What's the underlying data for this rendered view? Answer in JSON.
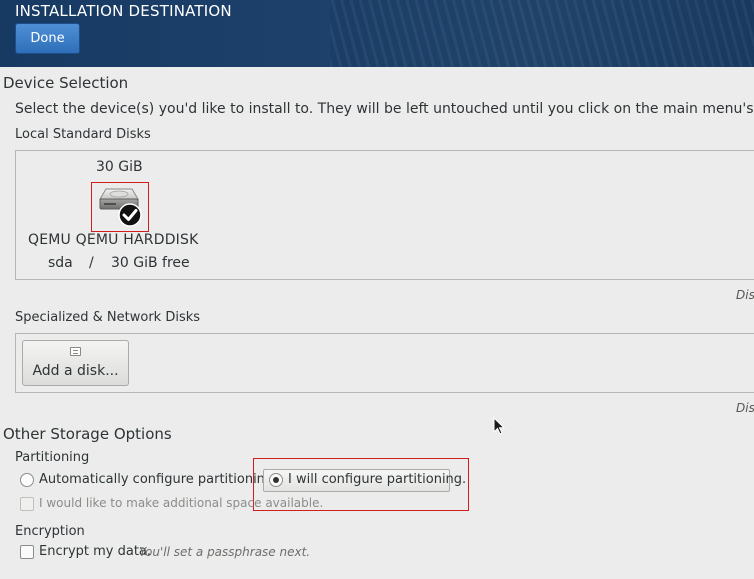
{
  "header": {
    "title": "INSTALLATION DESTINATION",
    "done_label": "Done"
  },
  "device_selection": {
    "heading": "Device Selection",
    "instruction": "Select the device(s) you'd like to install to.  They will be left untouched until you click on the main menu's \"",
    "local_disks": {
      "heading": "Local Standard Disks",
      "disks": [
        {
          "size": "30 GiB",
          "name": "QEMU QEMU HARDDISK",
          "device": "sda",
          "separator": "/",
          "free": "30 GiB free",
          "selected": true,
          "icon": "harddisk-icon"
        }
      ],
      "side_link": "Dis"
    },
    "network_disks": {
      "heading": "Specialized & Network Disks",
      "add_disk_label": "Add a disk...",
      "side_link": "Dis"
    }
  },
  "other_storage": {
    "heading": "Other Storage Options",
    "partitioning": {
      "heading": "Partitioning",
      "options": [
        {
          "label": "Automatically configure partitioning.",
          "selected": false
        },
        {
          "label": "I will configure partitioning.",
          "selected": true
        }
      ],
      "extra_space_label": "I would like to make additional space available.",
      "extra_space_checked": false,
      "extra_space_enabled": false
    },
    "encryption": {
      "heading": "Encryption",
      "label": "Encrypt my data.",
      "hint": "You'll set a passphrase next.",
      "checked": false
    }
  },
  "colors": {
    "header_bg": "#1d416b",
    "done_button": "#3a7bc8",
    "selection_outline": "#d21d1d",
    "background": "#ececec"
  }
}
